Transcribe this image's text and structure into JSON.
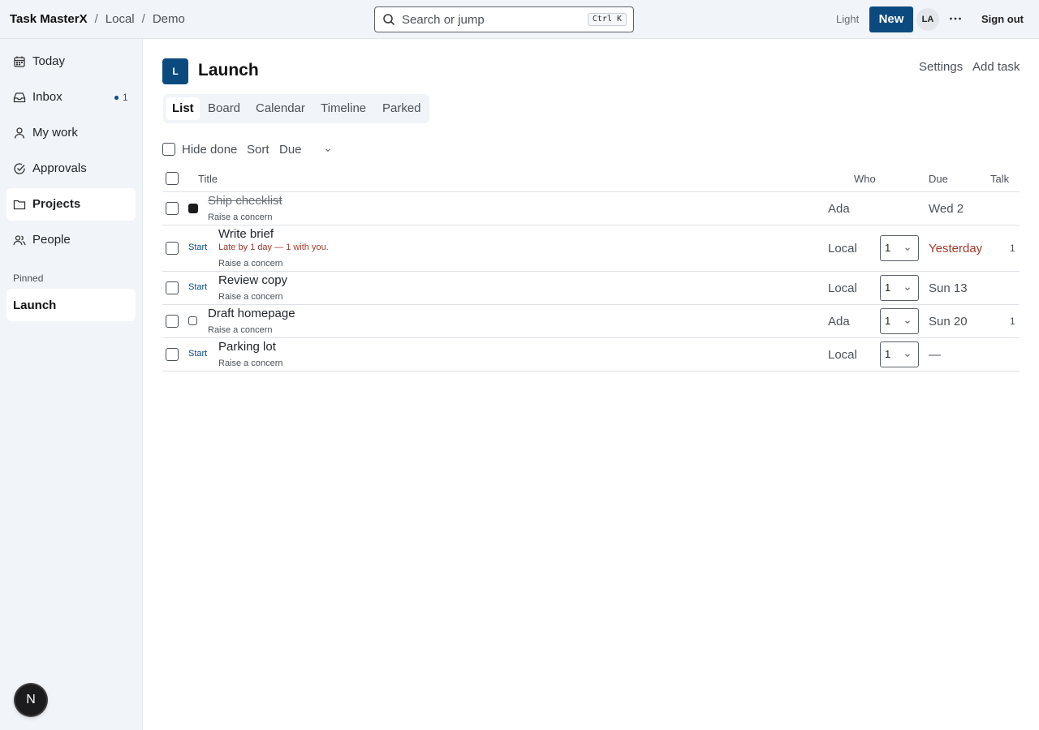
{
  "breadcrumb": {
    "brand": "Task MasterX",
    "items": [
      "Local",
      "Demo"
    ]
  },
  "search": {
    "placeholder": "Search or jump",
    "shortcut": "Ctrl K"
  },
  "topbar": {
    "theme_label": "Light",
    "new_label": "New",
    "avatar_initials": "LA",
    "sign_out_label": "Sign out"
  },
  "sidebar": {
    "items": [
      {
        "label": "Today",
        "icon": "calendar-icon"
      },
      {
        "label": "Inbox",
        "icon": "inbox-icon",
        "count": "1"
      },
      {
        "label": "My work",
        "icon": "person-icon"
      },
      {
        "label": "Approvals",
        "icon": "check-circle-icon"
      },
      {
        "label": "Projects",
        "icon": "folder-icon",
        "active": true
      },
      {
        "label": "People",
        "icon": "people-icon"
      }
    ],
    "pinned_label": "Pinned",
    "pinned": [
      {
        "label": "Launch"
      }
    ]
  },
  "badge": {
    "letter": "N"
  },
  "project": {
    "icon_letter": "L",
    "title": "Launch",
    "settings_label": "Settings",
    "add_task_label": "Add task"
  },
  "tabs": [
    "List",
    "Board",
    "Calendar",
    "Timeline",
    "Parked"
  ],
  "toolbar": {
    "hide_done_label": "Hide done",
    "sort_label": "Sort",
    "sort_value": "Due"
  },
  "table": {
    "headers": {
      "title": "Title",
      "who": "Who",
      "due": "Due",
      "talk": "Talk"
    },
    "rows": [
      {
        "title": "Ship checklist",
        "done": true,
        "sub": "Raise a concern",
        "who": "Ada",
        "due": "Wed 2",
        "talk": ""
      },
      {
        "title": "Write brief",
        "start": "Start",
        "late_note": "Late by 1 day — 1 with you.",
        "sub": "Raise a concern",
        "who": "Local",
        "select": "1",
        "due": "Yesterday",
        "due_late": true,
        "talk": "1"
      },
      {
        "title": "Review copy",
        "start": "Start",
        "sub": "Raise a concern",
        "who": "Local",
        "select": "1",
        "due": "Sun 13",
        "talk": ""
      },
      {
        "title": "Draft homepage",
        "sub": "Raise a concern",
        "who": "Ada",
        "select": "1",
        "due": "Sun 20",
        "talk": "1"
      },
      {
        "title": "Parking lot",
        "start": "Start",
        "sub": "Raise a concern",
        "who": "Local",
        "select": "1",
        "due": "—",
        "talk": ""
      }
    ]
  },
  "colors": {
    "accent": "#0b4a7f",
    "late": "#a33a2a",
    "chrome": "#f1f4f8"
  }
}
